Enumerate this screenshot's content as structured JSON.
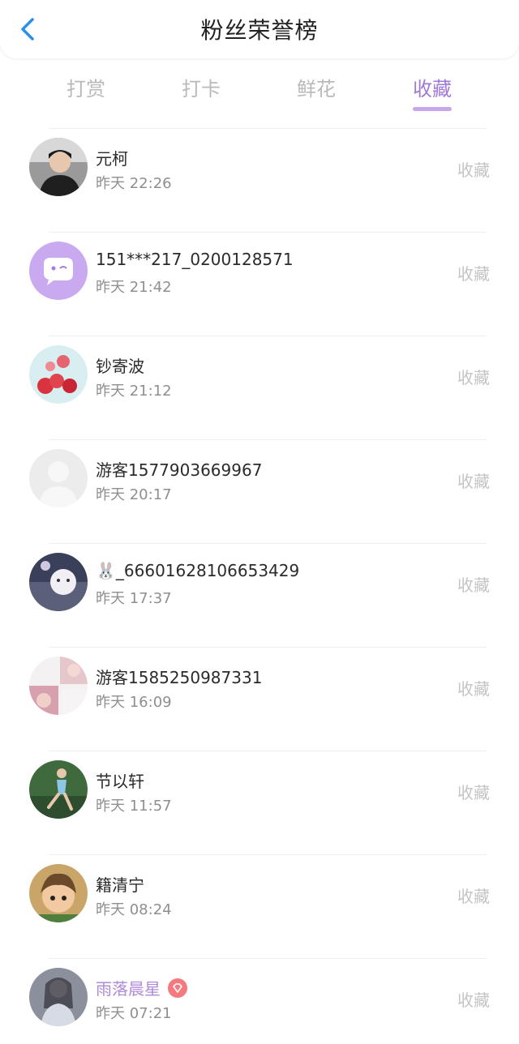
{
  "header": {
    "title": "粉丝荣誉榜",
    "back_icon": "chevron-left-icon"
  },
  "tabs": [
    {
      "label": "打赏",
      "active": false
    },
    {
      "label": "打卡",
      "active": false
    },
    {
      "label": "鲜花",
      "active": false
    },
    {
      "label": "收藏",
      "active": true
    }
  ],
  "colors": {
    "accent": "#a07ad6",
    "underline": "#c6a7ec",
    "back": "#2b8ef0"
  },
  "fans": [
    {
      "name": "元柯",
      "time": "昨天 22:26",
      "action": "收藏",
      "avatar": "photo-avatar-man"
    },
    {
      "name": "151***217_0200128571",
      "time": "昨天 21:42",
      "action": "收藏",
      "avatar": "default-chat-avatar"
    },
    {
      "name": "钞寄波",
      "time": "昨天 21:12",
      "action": "收藏",
      "avatar": "balloons-avatar"
    },
    {
      "name": "游客1577903669967",
      "time": "昨天 20:17",
      "action": "收藏",
      "avatar": "guest-placeholder-avatar"
    },
    {
      "name": "🐰_66601628106653429",
      "time": "昨天 17:37",
      "action": "收藏",
      "avatar": "cartoon-avatar"
    },
    {
      "name": "游客1585250987331",
      "time": "昨天 16:09",
      "action": "收藏",
      "avatar": "collage-avatar"
    },
    {
      "name": "节以轩",
      "time": "昨天 11:57",
      "action": "收藏",
      "avatar": "dancer-avatar"
    },
    {
      "name": "籍清宁",
      "time": "昨天 08:24",
      "action": "收藏",
      "avatar": "cartoon-boy-avatar"
    },
    {
      "name": "雨落晨星",
      "time": "昨天 07:21",
      "action": "收藏",
      "avatar": "portrait-avatar",
      "vip": true,
      "badge_icon": "diamond-badge-icon"
    }
  ]
}
